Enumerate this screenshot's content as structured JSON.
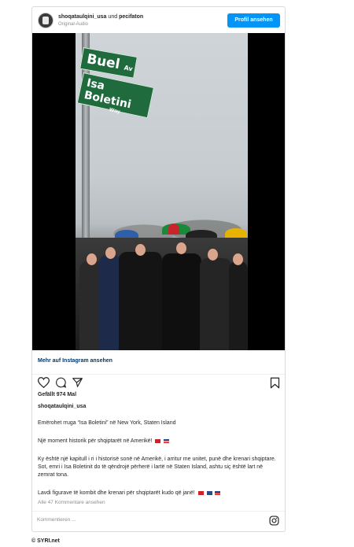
{
  "header": {
    "user1": "shoqataulqini_usa",
    "connector": "und",
    "user2": "pecifaton",
    "subtitle": "Original-Audio",
    "profile_button": "Profil ansehen"
  },
  "media": {
    "sign_top": "Buel",
    "sign_top_suffix": "Av",
    "sign_bottom": "Isa Boletini",
    "sign_bottom_suffix": "Way"
  },
  "more_link": "Mehr auf Instagram ansehen",
  "icons": [
    "heart-icon",
    "comment-icon",
    "share-icon",
    "bookmark-icon",
    "instagram-icon"
  ],
  "likes": "Gefällt 974 Mal",
  "caption": {
    "username": "shoqataulqini_usa",
    "line1": "Emërohet rruga “Isa Boletini” në New York, Staten Island",
    "line2": "Një moment historik për shqiptarët në Amerikë!",
    "line3": "Ky është një kapitull i ri i historisë sonë në Amerikë, i arritur me unitet, punë dhe krenari shqiptare. Sot, emri i Isa Boletinit do të qëndrojë përherë i lartë në Staten Island, ashtu siç është lart në zemrat tona.",
    "line4": "Lavdi figurave të kombit dhe krenari për shqiptarët kudo që janë!"
  },
  "comments_link": "Alle 47 Kommentare ansehen",
  "comment_placeholder": "Kommentieren ...",
  "footer": "© SYRI.net",
  "colors": {
    "accent": "#0095f6",
    "link": "#00376b",
    "sign_green": "#1f6b3e"
  }
}
